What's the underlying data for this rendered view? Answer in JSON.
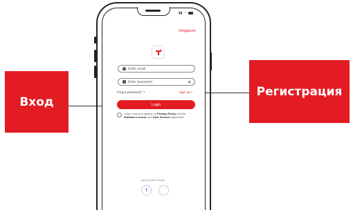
{
  "callouts": {
    "login": "Вход",
    "register": "Регистрация"
  },
  "app": {
    "region": "Singapore",
    "email_placeholder": "Enter email",
    "password_placeholder": "Enter password",
    "forgot_password": "Forgot password？>",
    "sign_up": "Sign up >",
    "login_button": "Login",
    "agreement": {
      "part1": "I have read and agreed on ",
      "privacy": "Privacy Policy",
      "part2": " and the ",
      "software": "Software License",
      "part3": " and ",
      "user_service": "User Service",
      "part4": " Agreement"
    },
    "other_login": "Log in by other means"
  },
  "colors": {
    "brand_red": "#e31b23"
  },
  "icons": [
    "person-icon",
    "lock-icon",
    "eye-icon",
    "facebook-icon",
    "apple-icon",
    "logo-icon"
  ]
}
